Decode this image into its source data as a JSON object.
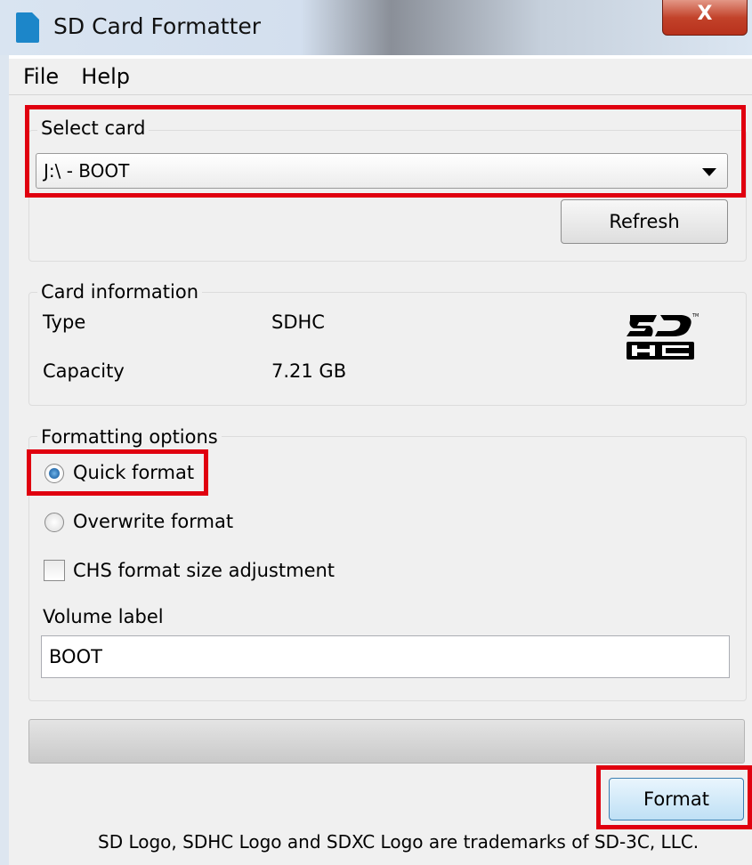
{
  "window": {
    "title": "SD Card Formatter",
    "close_glyph": "X",
    "icon": "sd-card-icon"
  },
  "menu": {
    "items": [
      "File",
      "Help"
    ]
  },
  "select_card": {
    "group_label": "Select card",
    "selected": "J:\\ - BOOT",
    "refresh_label": "Refresh"
  },
  "card_info": {
    "group_label": "Card information",
    "type_label": "Type",
    "type_value": "SDHC",
    "capacity_label": "Capacity",
    "capacity_value": "7.21 GB",
    "logo": "sdhc-logo"
  },
  "format_options": {
    "group_label": "Formatting options",
    "quick_format": "Quick format",
    "quick_format_checked": true,
    "overwrite_format": "Overwrite format",
    "overwrite_format_checked": false,
    "chs_adjustment": "CHS format size adjustment",
    "chs_adjustment_checked": false,
    "volume_label_title": "Volume label",
    "volume_label_value": "BOOT"
  },
  "progress": {
    "fraction": 0
  },
  "format_button_label": "Format",
  "footer_text": "SD Logo, SDHC Logo and SDXC Logo are trademarks of SD-3C, LLC.",
  "colors": {
    "highlight": "#e0000f",
    "title_bar": "#d9e4f1",
    "close_button": "#c2422a",
    "app_icon": "#1c86c9"
  }
}
